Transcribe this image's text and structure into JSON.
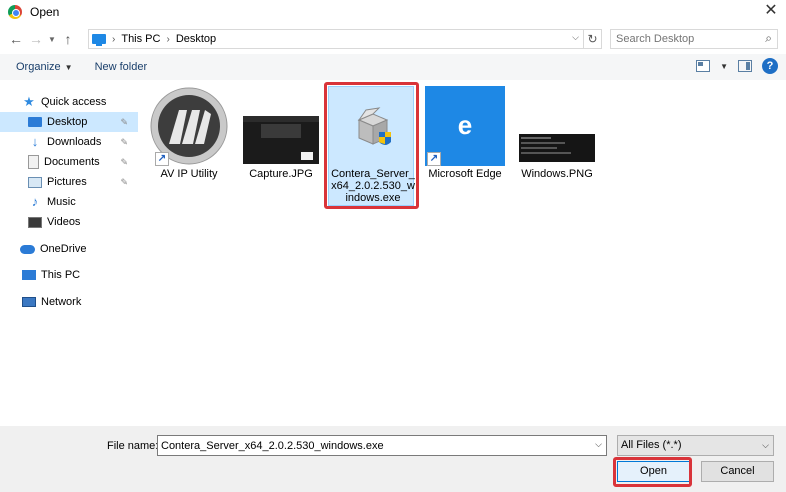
{
  "window": {
    "title": "Open",
    "close_glyph": "✕"
  },
  "address": {
    "crumbs": [
      "This PC",
      "Desktop"
    ],
    "search_placeholder": "Search Desktop"
  },
  "toolbar": {
    "organize_label": "Organize",
    "new_folder_label": "New folder",
    "help_glyph": "?"
  },
  "sidebar": {
    "items": [
      {
        "label": "Quick access"
      },
      {
        "label": "Desktop"
      },
      {
        "label": "Downloads"
      },
      {
        "label": "Documents"
      },
      {
        "label": "Pictures"
      },
      {
        "label": "Music"
      },
      {
        "label": "Videos"
      },
      {
        "label": "OneDrive"
      },
      {
        "label": "This PC"
      },
      {
        "label": "Network"
      }
    ]
  },
  "files": [
    {
      "label": "AV IP Utility"
    },
    {
      "label": "Capture.JPG"
    },
    {
      "label": "Contera_Server_x64_2.0.2.530_windows.exe"
    },
    {
      "label": "Microsoft Edge"
    },
    {
      "label": "Windows.PNG"
    }
  ],
  "footer": {
    "file_name_label": "File name:",
    "file_name_value": "Contera_Server_x64_2.0.2.530_windows.exe",
    "filter_value": "All Files (*.*)",
    "open_label": "Open",
    "cancel_label": "Cancel"
  },
  "colors": {
    "highlight": "#d9343a",
    "selection": "#cce8ff",
    "accent": "#0078d7"
  }
}
